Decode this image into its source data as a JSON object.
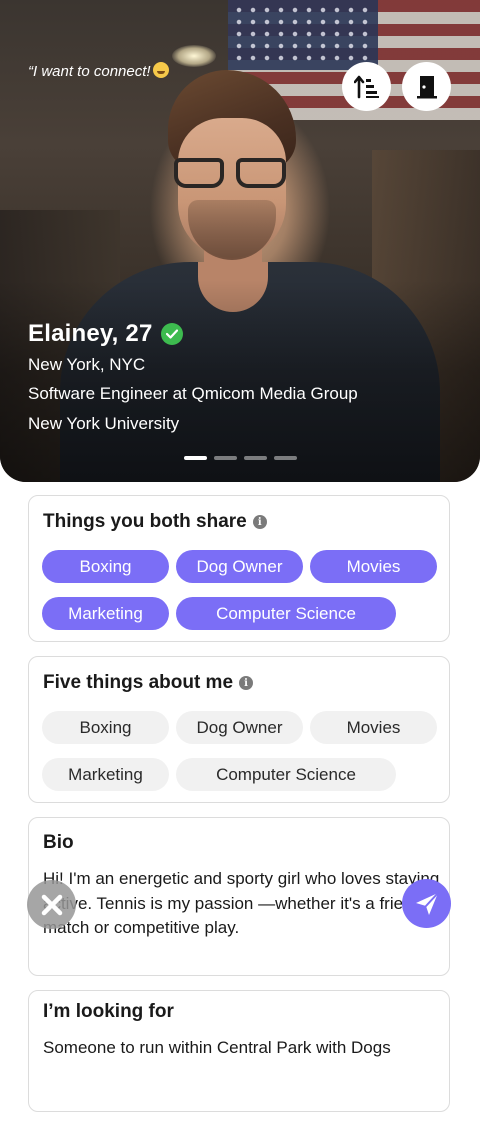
{
  "profile": {
    "quote": "“I want to connect!",
    "name_age": "Elainey, 27",
    "city": "New York, NYC",
    "job": "Software Engineer at Qmicom Media Group",
    "education": "New York University",
    "photo_index": 1,
    "photo_count": 4
  },
  "actions": {
    "sort_icon": "sort-ascending-icon",
    "door_icon": "exit-door-icon",
    "dismiss_icon": "close-icon",
    "send_icon": "send-icon"
  },
  "shared": {
    "title": "Things you both share",
    "tags": [
      "Boxing",
      "Dog Owner",
      "Movies",
      "Marketing",
      "Computer Science"
    ]
  },
  "five_things": {
    "title": "Five things about me",
    "tags": [
      "Boxing",
      "Dog Owner",
      "Movies",
      "Marketing",
      "Computer Science"
    ]
  },
  "bio": {
    "title": "Bio",
    "text": "Hi! I'm an energetic and sporty girl who loves staying active. Tennis is my passion —whether it's a friendly match or competitive play."
  },
  "looking_for": {
    "title": "I’m looking for",
    "text": "Someone to run within Central Park with Dogs"
  },
  "colors": {
    "accent": "#7b6ef6",
    "verified": "#3dbb4f",
    "chip_inactive": "#f1f1f1"
  }
}
